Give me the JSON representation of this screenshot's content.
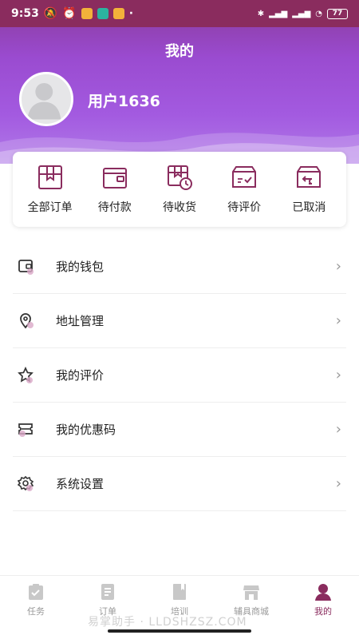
{
  "status_bar": {
    "time": "9:53",
    "battery": "77"
  },
  "header": {
    "title": "我的",
    "username": "用户1636"
  },
  "orders": [
    {
      "label": "全部订单",
      "icon": "all-orders-icon"
    },
    {
      "label": "待付款",
      "icon": "wallet-pay-icon"
    },
    {
      "label": "待收货",
      "icon": "box-clock-icon"
    },
    {
      "label": "待评价",
      "icon": "box-check-icon"
    },
    {
      "label": "已取消",
      "icon": "box-return-icon"
    }
  ],
  "menu": [
    {
      "label": "我的钱包",
      "icon": "wallet-icon"
    },
    {
      "label": "地址管理",
      "icon": "location-pin-icon"
    },
    {
      "label": "我的评价",
      "icon": "star-icon"
    },
    {
      "label": "我的优惠码",
      "icon": "coupon-icon"
    },
    {
      "label": "系统设置",
      "icon": "gear-icon"
    }
  ],
  "tabs": [
    {
      "label": "任务",
      "icon": "task-icon",
      "active": false
    },
    {
      "label": "订单",
      "icon": "order-list-icon",
      "active": false
    },
    {
      "label": "培训",
      "icon": "book-icon",
      "active": false
    },
    {
      "label": "辅具商城",
      "icon": "shop-icon",
      "active": false
    },
    {
      "label": "我的",
      "icon": "user-icon",
      "active": true
    }
  ],
  "watermark": "易掌助手 · LLDSHZSZ.COM",
  "colors": {
    "accent": "#8a2c5e",
    "gradient_top": "#8a3a9a",
    "gradient_bottom": "#b07ae8"
  }
}
